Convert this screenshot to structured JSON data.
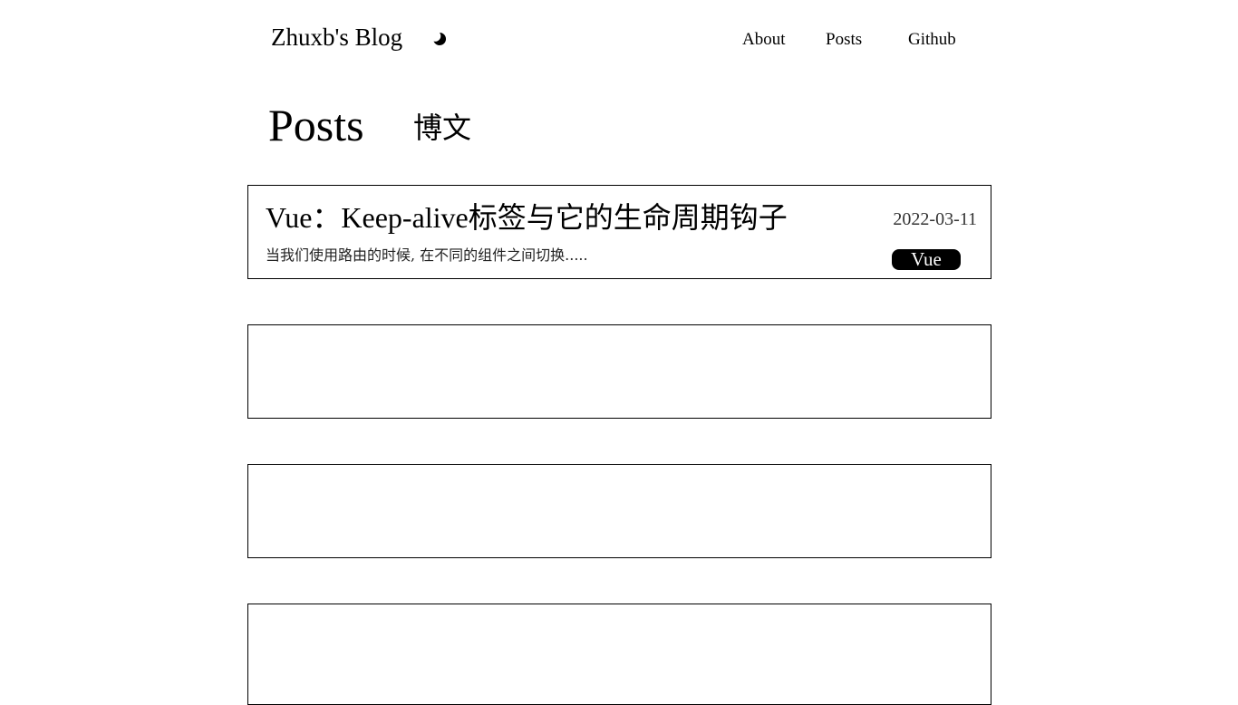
{
  "header": {
    "site_title": "Zhuxb's Blog",
    "theme_icon": "moon-icon",
    "nav": {
      "about": "About",
      "posts": "Posts",
      "github": "Github"
    }
  },
  "page": {
    "title": "Posts",
    "subtitle": "博文"
  },
  "posts": [
    {
      "title": "Vue：Keep-alive标签与它的生命周期钩子",
      "date": "2022-03-11",
      "excerpt": "当我们使用路由的时候, 在不同的组件之间切换.....",
      "tag": "Vue"
    }
  ],
  "colors": {
    "text": "#000000",
    "background": "#ffffff",
    "tag_background": "#000000",
    "tag_text": "#ffffff"
  }
}
